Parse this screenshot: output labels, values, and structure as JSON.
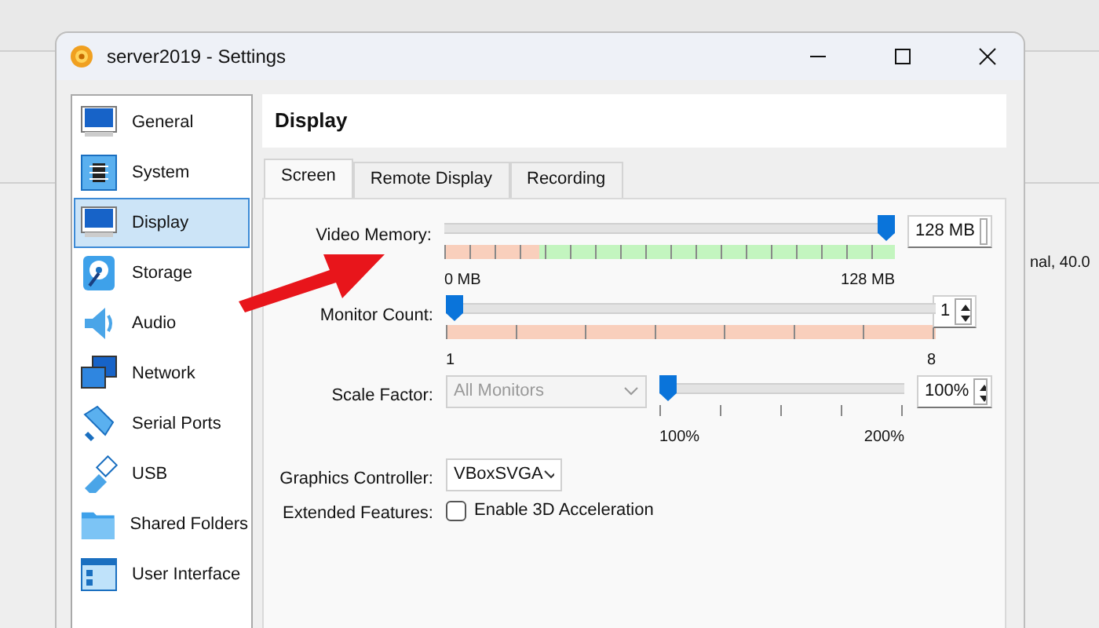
{
  "window": {
    "title": "server2019 - Settings"
  },
  "background_text": "nal, 40.0",
  "sidebar": {
    "items": [
      {
        "label": "General",
        "kind": "general",
        "selected": false
      },
      {
        "label": "System",
        "kind": "system",
        "selected": false
      },
      {
        "label": "Display",
        "kind": "display",
        "selected": true
      },
      {
        "label": "Storage",
        "kind": "storage",
        "selected": false
      },
      {
        "label": "Audio",
        "kind": "audio",
        "selected": false
      },
      {
        "label": "Network",
        "kind": "network",
        "selected": false
      },
      {
        "label": "Serial Ports",
        "kind": "serial",
        "selected": false
      },
      {
        "label": "USB",
        "kind": "usb",
        "selected": false
      },
      {
        "label": "Shared Folders",
        "kind": "folders",
        "selected": false
      },
      {
        "label": "User Interface",
        "kind": "ui",
        "selected": false
      }
    ]
  },
  "page_title": "Display",
  "tabs": [
    {
      "label": "Screen",
      "selected": true
    },
    {
      "label": "Remote Display",
      "selected": false
    },
    {
      "label": "Recording",
      "selected": false
    }
  ],
  "video_memory": {
    "label": "Video Memory:",
    "level": 1,
    "value": "128 MB",
    "min_label": "0 MB",
    "max_label": "128 MB"
  },
  "monitor_count": {
    "label": "Monitor Count:",
    "level": 0,
    "value": "1",
    "min_label": "1",
    "max_label": "8"
  },
  "scale_factor": {
    "label": "Scale Factor:",
    "monitor_select": {
      "value": "All Monitors",
      "disabled": true
    },
    "level": 0,
    "value": "100%",
    "min_label": "100%",
    "max_label": "200%"
  },
  "graphics_controller": {
    "label": "Graphics Controller:",
    "value": "VBoxSVGA"
  },
  "extended_features": {
    "label": "Extended Features:",
    "checkbox": {
      "label": "Enable 3D Acceleration",
      "checked": false
    }
  }
}
